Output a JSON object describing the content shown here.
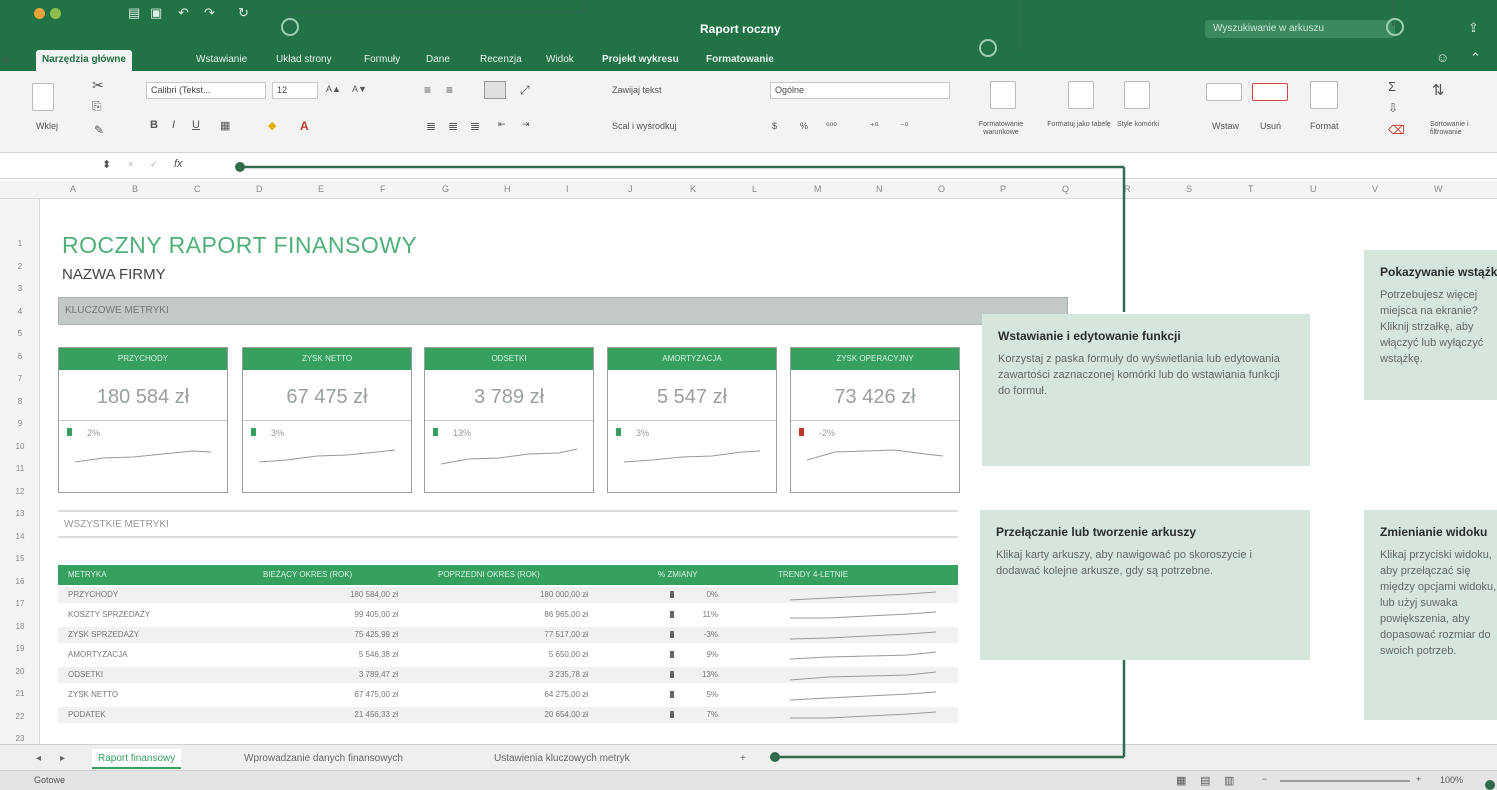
{
  "window": {
    "title": "Raport roczny",
    "search_placeholder": "Wyszukiwanie w arkuszu"
  },
  "tabs": [
    "Narzędzia główne",
    "Wstawianie",
    "Układ strony",
    "Formuły",
    "Dane",
    "Recenzja",
    "Widok",
    "Projekt wykresu",
    "Formatowanie"
  ],
  "ribbon": {
    "paste": "Wklej",
    "font": "Calibri (Tekst...",
    "font_size": "12",
    "font_grow": "A▲",
    "font_shrink": "A▼",
    "bold": "B",
    "italic": "I",
    "underline": "U",
    "wrap": "Zawijaj tekst",
    "merge": "Scal i wyśrodkuj",
    "number_format": "Ogólne",
    "currency": "$",
    "percent": "%",
    "cond_format": "Formatowanie warunkowe",
    "format_table": "Formatuj jako tabelę",
    "cell_styles": "Style komórki",
    "insert": "Wstaw",
    "delete": "Usuń",
    "format": "Format",
    "sort": "Sortowanie i filtrowanie"
  },
  "formula_bar": {
    "fx": "fx"
  },
  "columns": [
    "A",
    "B",
    "C",
    "D",
    "E",
    "F",
    "G",
    "H",
    "I",
    "J",
    "K",
    "L",
    "M",
    "N",
    "O",
    "P",
    "Q",
    "R",
    "S",
    "T",
    "U",
    "V",
    "W"
  ],
  "rows": [
    "1",
    "2",
    "3",
    "4",
    "5",
    "6",
    "7",
    "8",
    "9",
    "10",
    "11",
    "12",
    "13",
    "14",
    "15",
    "16",
    "17",
    "18",
    "19",
    "20",
    "21",
    "22",
    "23"
  ],
  "report": {
    "title": "ROCZNY RAPORT FINANSOWY",
    "company": "NAZWA FIRMY",
    "kpi_section": "KLUCZOWE METRYKI",
    "all_section": "WSZYSTKIE METRYKI",
    "cards": [
      {
        "title": "PRZYCHODY",
        "value": "180 584 zł",
        "change": "2%"
      },
      {
        "title": "ZYSK NETTO",
        "value": "67 475 zł",
        "change": "3%"
      },
      {
        "title": "ODSETKI",
        "value": "3 789 zł",
        "change": "13%"
      },
      {
        "title": "AMORTYZACJA",
        "value": "5 547 zł",
        "change": "3%"
      },
      {
        "title": "ZYSK OPERACYJNY",
        "value": "73 426 zł",
        "change": "-2%"
      }
    ],
    "table": {
      "headers": [
        "METRYKA",
        "BIEŻĄCY OKRES (ROK)",
        "POPRZEDNI OKRES (ROK)",
        "% ZMIANY",
        "TRENDY 4-LETNIE"
      ],
      "rows": [
        [
          "PRZYCHODY",
          "180 584,00 zł",
          "180 000,00 zł",
          "0%"
        ],
        [
          "KOSZTY SPRZEDAŻY",
          "99 405,00 zł",
          "86 965,00 zł",
          "11%"
        ],
        [
          "ZYSK SPRZEDAŻY",
          "75 425,99 zł",
          "77 517,00 zł",
          "-3%"
        ],
        [
          "AMORTYZACJA",
          "5 546,38 zł",
          "5 650,00 zł",
          "9%"
        ],
        [
          "ODSETKI",
          "3 789,47 zł",
          "3 235,78 zł",
          "13%"
        ],
        [
          "ZYSK NETTO",
          "67 475,00 zł",
          "64 275,00 zł",
          "5%"
        ],
        [
          "PODATEK",
          "21 456,33 zł",
          "20 654,00 zł",
          "7%"
        ]
      ]
    }
  },
  "sheet_tabs": [
    "Raport finansowy",
    "Wprowadzanie danych finansowych",
    "Ustawienia kluczowych metryk"
  ],
  "add_sheet": "+",
  "status": "Gotowe",
  "zoom": "100%",
  "callouts": [
    {
      "title": "Wstawianie i edytowanie funkcji",
      "body": "Korzystaj z paska formuły do wyświetlania lub edytowania zawartości zaznaczonej komórki lub do wstawiania funkcji do formuł."
    },
    {
      "title": "Przełączanie lub tworzenie arkuszy",
      "body": "Klikaj karty arkuszy, aby nawigować po skoroszycie i dodawać kolejne arkusze, gdy są potrzebne."
    },
    {
      "title": "Pokazywanie wstążki",
      "body": "Potrzebujesz więcej miejsca na ekranie? Kliknij strzałkę, aby włączyć lub wyłączyć wstążkę."
    },
    {
      "title": "Zmienianie widoku",
      "body": "Klikaj przyciski widoku, aby przełączać się między opcjami widoku, lub użyj suwaka powiększenia, aby dopasować rozmiar do swoich potrzeb."
    }
  ],
  "colors": {
    "brand": "#217346",
    "accent": "#37a05f",
    "callout_bg": "#d6e6dd"
  }
}
